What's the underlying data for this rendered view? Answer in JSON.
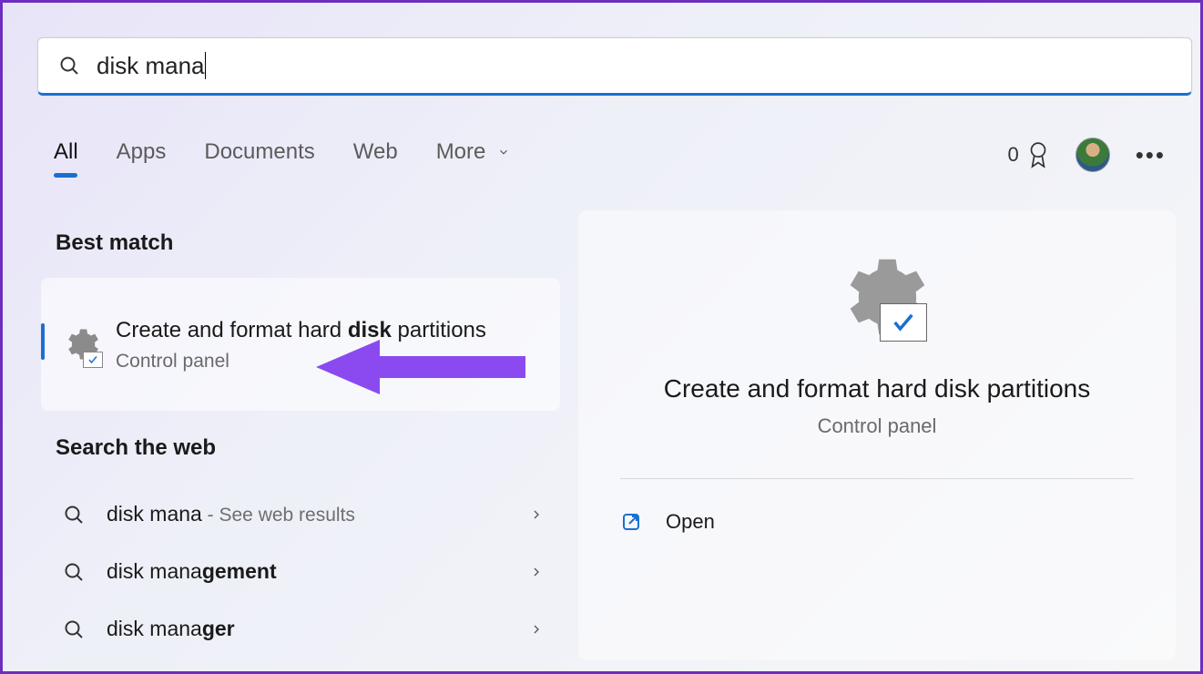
{
  "search": {
    "value": "disk mana"
  },
  "tabs": {
    "all": "All",
    "apps": "Apps",
    "documents": "Documents",
    "web": "Web",
    "more": "More"
  },
  "rewards": {
    "count": "0"
  },
  "sections": {
    "best_match": "Best match",
    "search_web": "Search the web"
  },
  "best_match": {
    "title_prefix": "Create and format hard ",
    "title_bold1": "disk",
    "title_mid": " partitions",
    "subtitle": "Control panel"
  },
  "web_results": [
    {
      "prefix": "disk mana",
      "bold": "",
      "hint": " - See web results"
    },
    {
      "prefix": "disk mana",
      "bold": "gement",
      "hint": ""
    },
    {
      "prefix": "disk mana",
      "bold": "ger",
      "hint": ""
    }
  ],
  "detail": {
    "title": "Create and format hard disk partitions",
    "subtitle": "Control panel",
    "open": "Open"
  }
}
